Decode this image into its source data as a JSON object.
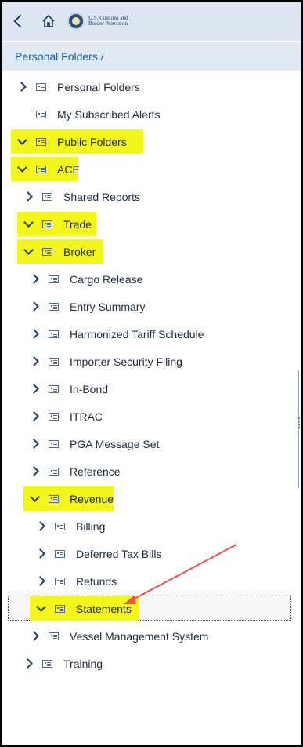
{
  "header": {
    "back_icon": "chevron-left-icon",
    "home_icon": "home-icon",
    "logo_line1": "U.S. Customs and",
    "logo_line2": "Border Protection"
  },
  "breadcrumb": {
    "text": "Personal Folders /"
  },
  "tree": [
    {
      "label": "Personal Folders",
      "indent": 0,
      "state": "collapsed",
      "highlighted": false,
      "selected": false
    },
    {
      "label": "My Subscribed Alerts",
      "indent": 0,
      "state": "leaf",
      "highlighted": false,
      "selected": false
    },
    {
      "label": "Public Folders",
      "indent": 0,
      "state": "expanded",
      "highlighted": true,
      "selected": false
    },
    {
      "label": "ACE",
      "indent": 0,
      "state": "expanded",
      "highlighted": true,
      "selected": false
    },
    {
      "label": "Shared Reports",
      "indent": 1,
      "state": "collapsed",
      "highlighted": false,
      "selected": false
    },
    {
      "label": "Trade",
      "indent": 1,
      "state": "expanded",
      "highlighted": true,
      "selected": false
    },
    {
      "label": "Broker",
      "indent": 1,
      "state": "expanded",
      "highlighted": true,
      "selected": false
    },
    {
      "label": "Cargo Release",
      "indent": 2,
      "state": "collapsed",
      "highlighted": false,
      "selected": false
    },
    {
      "label": "Entry Summary",
      "indent": 2,
      "state": "collapsed",
      "highlighted": false,
      "selected": false
    },
    {
      "label": "Harmonized Tariff Schedule",
      "indent": 2,
      "state": "collapsed",
      "highlighted": false,
      "selected": false
    },
    {
      "label": "Importer Security Filing",
      "indent": 2,
      "state": "collapsed",
      "highlighted": false,
      "selected": false
    },
    {
      "label": "In-Bond",
      "indent": 2,
      "state": "collapsed",
      "highlighted": false,
      "selected": false
    },
    {
      "label": "ITRAC",
      "indent": 2,
      "state": "collapsed",
      "highlighted": false,
      "selected": false
    },
    {
      "label": "PGA Message Set",
      "indent": 2,
      "state": "collapsed",
      "highlighted": false,
      "selected": false
    },
    {
      "label": "Reference",
      "indent": 2,
      "state": "collapsed",
      "highlighted": false,
      "selected": false
    },
    {
      "label": "Revenue",
      "indent": 2,
      "state": "expanded",
      "highlighted": true,
      "selected": false
    },
    {
      "label": "Billing",
      "indent": 3,
      "state": "collapsed",
      "highlighted": false,
      "selected": false
    },
    {
      "label": "Deferred Tax Bills",
      "indent": 3,
      "state": "collapsed",
      "highlighted": false,
      "selected": false
    },
    {
      "label": "Refunds",
      "indent": 3,
      "state": "collapsed",
      "highlighted": false,
      "selected": false
    },
    {
      "label": "Statements",
      "indent": 3,
      "state": "expanded",
      "highlighted": true,
      "selected": true
    },
    {
      "label": "Vessel Management System",
      "indent": 2,
      "state": "collapsed",
      "highlighted": false,
      "selected": false
    },
    {
      "label": "Training",
      "indent": 1,
      "state": "collapsed",
      "highlighted": false,
      "selected": false
    }
  ],
  "colors": {
    "highlight": "#f4f61a",
    "header_bg": "#dce6f0",
    "breadcrumb_link": "#1a5fa8",
    "arrow": "#e8534f"
  }
}
